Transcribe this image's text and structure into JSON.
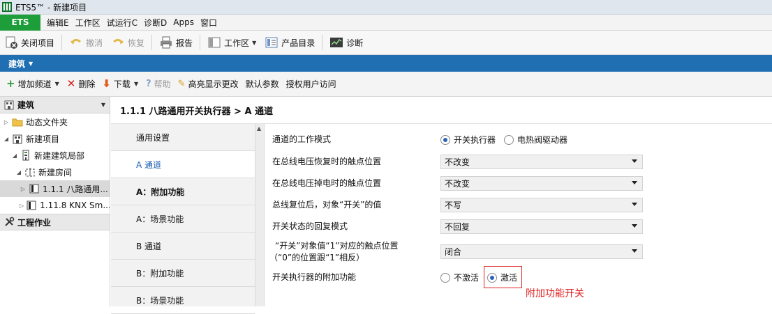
{
  "window": {
    "title": "ETS5™ - 新建项目"
  },
  "menubar": {
    "ets_tab": "ETS",
    "items": [
      "编辑E",
      "工作区",
      "试运行C",
      "诊断D",
      "Apps",
      "窗口"
    ]
  },
  "toolbar": {
    "close_project": "关闭项目",
    "undo": "撤消",
    "redo": "恢复",
    "report": "报告",
    "workspace": "工作区",
    "catalog": "产品目录",
    "diagnostics": "诊断"
  },
  "bluebar": {
    "label": "建筑"
  },
  "actions": {
    "add_channel": "增加频道",
    "delete": "删除",
    "download": "下载",
    "help": "帮助",
    "highlight_changes": "高亮显示更改",
    "default_params": "默认参数",
    "grant_access": "授权用户访问"
  },
  "tree": {
    "header": "建筑",
    "items": [
      {
        "label": "动态文件夹"
      },
      {
        "label": "新建项目"
      },
      {
        "label": "新建建筑局部"
      },
      {
        "label": "新建房间"
      },
      {
        "label": "1.1.1 八路通用..."
      },
      {
        "label": "1.11.8 KNX Sm..."
      }
    ],
    "work_header": "工程作业"
  },
  "main": {
    "title": "1.1.1 八路通用开关执行器 > A 通道",
    "subnav": [
      "通用设置",
      "A 通道",
      "A：附加功能",
      "A：场景功能",
      "B 通道",
      "B：附加功能",
      "B：场景功能"
    ]
  },
  "params": {
    "mode_label": "通道的工作模式",
    "mode_opt1": "开关执行器",
    "mode_opt2": "电热阀驱动器",
    "recover_label": "在总线电压恢复时的触点位置",
    "recover_value": "不改变",
    "lost_label": "在总线电压掉电时的触点位置",
    "lost_value": "不改变",
    "reset_label": "总线复位后，对象“开关”的值",
    "reset_value": "不写",
    "reply_label": "开关状态的回复模式",
    "reply_value": "不回复",
    "contact_label_1": "“开关”对象值“1”对应的触点位置",
    "contact_label_2": "（“0”的位置跟“1”相反）",
    "contact_value": "闭合",
    "extra_label": "开关执行器的附加功能",
    "extra_opt1": "不激活",
    "extra_opt2": "激活"
  },
  "annotation": "附加功能开关"
}
